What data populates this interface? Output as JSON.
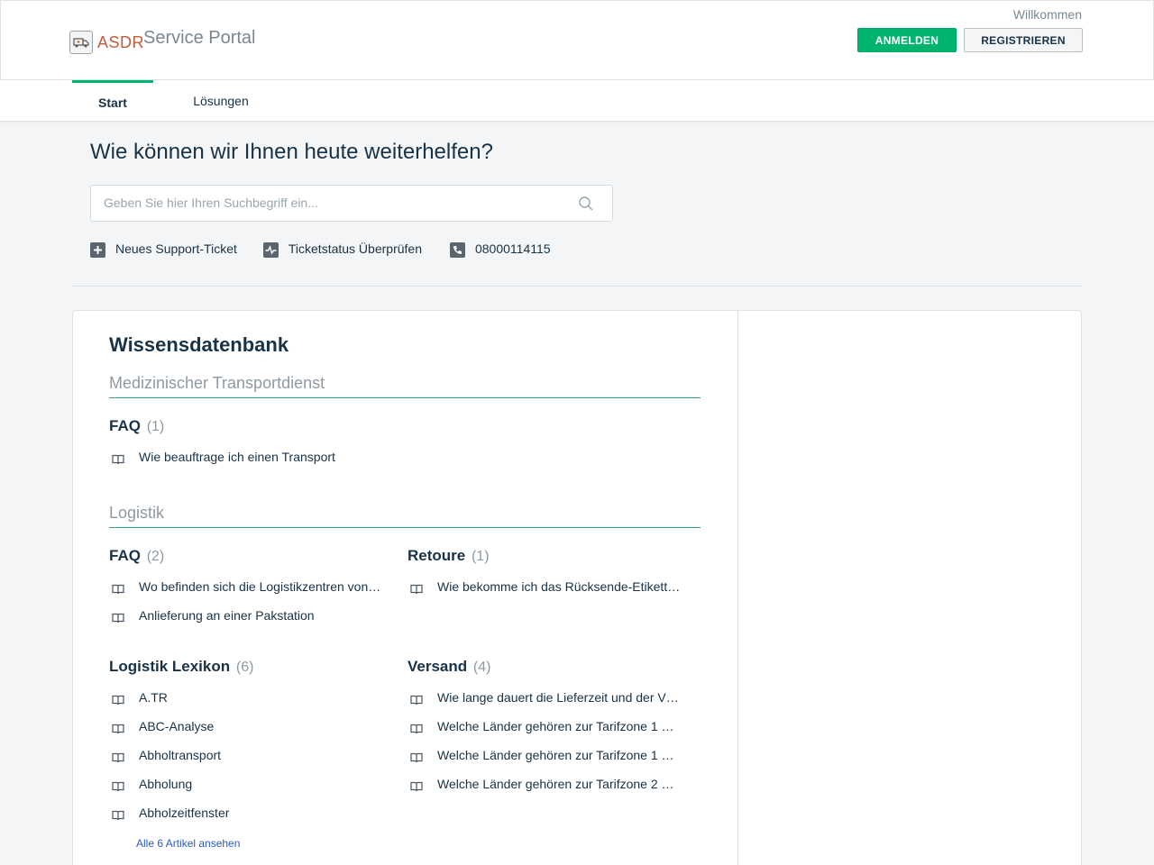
{
  "header": {
    "logo_text": "ASDR",
    "portal_name": "Service Portal",
    "welcome": "Willkommen",
    "login_label": "ANMELDEN",
    "register_label": "REGISTRIEREN",
    "accent_color": "#00b46e"
  },
  "nav": {
    "tabs": [
      {
        "label": "Start",
        "active": true
      },
      {
        "label": "Lösungen",
        "active": false
      }
    ]
  },
  "search": {
    "headline": "Wie können wir Ihnen heute weiterhelfen?",
    "placeholder": "Geben Sie hier Ihren Suchbegriff ein...",
    "value": ""
  },
  "quicklinks": [
    {
      "label": "Neues Support-Ticket",
      "icon": "plus-icon"
    },
    {
      "label": "Ticketstatus Überprüfen",
      "icon": "activity-icon"
    },
    {
      "label": "08000114115",
      "icon": "phone-icon"
    }
  ],
  "kb": {
    "title": "Wissensdatenbank",
    "categories": [
      {
        "name": "Medizinischer Transportdienst",
        "folders": [
          {
            "name": "FAQ",
            "count": "(1)",
            "articles": [
              "Wie beauftrage ich einen Transport"
            ]
          }
        ]
      },
      {
        "name": "Logistik",
        "folders": [
          {
            "name": "FAQ",
            "count": "(2)",
            "articles": [
              "Wo befinden sich die Logistikzentren von…",
              "Anlieferung an einer Pakstation"
            ]
          },
          {
            "name": "Retoure",
            "count": "(1)",
            "articles": [
              "Wie bekomme ich das Rücksende-Etikett…"
            ]
          },
          {
            "name": "Logistik Lexikon",
            "count": "(6)",
            "articles": [
              "A.TR",
              "ABC-Analyse",
              "Abholtransport",
              "Abholung",
              "Abholzeitfenster"
            ],
            "see_all": "Alle 6 Artikel ansehen"
          },
          {
            "name": "Versand",
            "count": "(4)",
            "articles": [
              "Wie lange dauert die Lieferzeit und der V…",
              "Welche Länder gehören zur Tarifzone 1 …",
              "Welche Länder gehören zur Tarifzone 1 …",
              "Welche Länder gehören zur Tarifzone 2 …"
            ]
          }
        ]
      }
    ]
  }
}
